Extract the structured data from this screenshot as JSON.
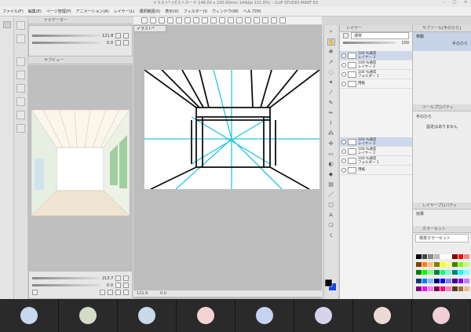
{
  "window": {
    "title": "イラスト* (ポストカード 148.00 x 100.00mm 144dpi 121.8%) - CLIP STUDIO PAINT EX"
  },
  "menu": [
    "ファイル(F)",
    "編集(E)",
    "ページ管理(P)",
    "アニメーション(A)",
    "レイヤー(L)",
    "選択範囲(S)",
    "表示(V)",
    "フィルター(I)",
    "ウィンドウ(W)",
    "ヘルプ(H)"
  ],
  "panels": {
    "navigator": {
      "title": "ナビゲーター",
      "zoom": "121.8",
      "rotate": "0.0"
    },
    "subview": {
      "title": "サブビュー",
      "zoom": "213.7",
      "rotate": "0.0"
    },
    "canvas_tab": "イラスト*",
    "status_zoom": "121.8",
    "status_rot": "0.0"
  },
  "layers": {
    "tab_label": "レイヤー",
    "blend": "通常",
    "opacity": "100",
    "top_rows": [
      {
        "pct": "100 %通常",
        "name": "レイヤー 3",
        "selected": true
      },
      {
        "pct": "100 %通常",
        "name": "レイヤー 2",
        "selected": false
      },
      {
        "pct": "100 %通常",
        "name": "フォルダー 1",
        "selected": false
      },
      {
        "name": "用紙",
        "selected": false
      }
    ],
    "bottom_rows": [
      {
        "pct": "100 %通常",
        "name": "レイヤー 3",
        "selected": true
      },
      {
        "pct": "100 %通常",
        "name": "レイヤー 2",
        "selected": false
      },
      {
        "pct": "100 %通常",
        "name": "フォルダー 1",
        "selected": false
      },
      {
        "name": "用紙",
        "selected": false
      }
    ]
  },
  "right": {
    "subtool_tab": "サブツール[手のひら]",
    "items": [
      "移動",
      "手のひら"
    ],
    "tool_prop_tab": "ツールプロパティ",
    "tool_prop_title": "手のひら",
    "tool_prop_msg": "設定はありません",
    "layer_prop_tab": "レイヤープロパティ",
    "effect_label": "効果",
    "color_set_tab": "カラーセット",
    "color_set_name": "標準カラーセット"
  },
  "colors": {
    "accent": "#3a6bd6",
    "selected": "#cdd8ec",
    "guide": "#26c6e8",
    "palette": [
      "#000000",
      "#444444",
      "#888888",
      "#bbbbbb",
      "#ffffff",
      "#ffffff",
      "#7f0000",
      "#ff0000",
      "#ff8080",
      "#7f3f00",
      "#ff7f00",
      "#ffbf80",
      "#7f7f00",
      "#ffff00",
      "#ffff80",
      "#3f7f00",
      "#7fff00",
      "#bfff80",
      "#007f00",
      "#00ff00",
      "#80ff80",
      "#007f3f",
      "#00ff7f",
      "#80ffbf",
      "#007f7f",
      "#00ffff",
      "#80ffff",
      "#003f7f",
      "#007fff",
      "#80bfff",
      "#00007f",
      "#0000ff",
      "#8080ff",
      "#3f007f",
      "#7f00ff",
      "#bf80ff",
      "#7f007f",
      "#ff00ff",
      "#ff80ff",
      "#7f003f",
      "#ff007f",
      "#ff80bf",
      "#5a3a1e",
      "#a0703c",
      "#e8c090"
    ]
  },
  "meeting": {
    "avatar_colors": [
      "#c7d7ee",
      "#d4dbc9",
      "#c8d9ea",
      "#f5d3d5",
      "#c5d3f0",
      "#d5d3ec",
      "#ecdad6",
      "#f0cfd8"
    ]
  }
}
